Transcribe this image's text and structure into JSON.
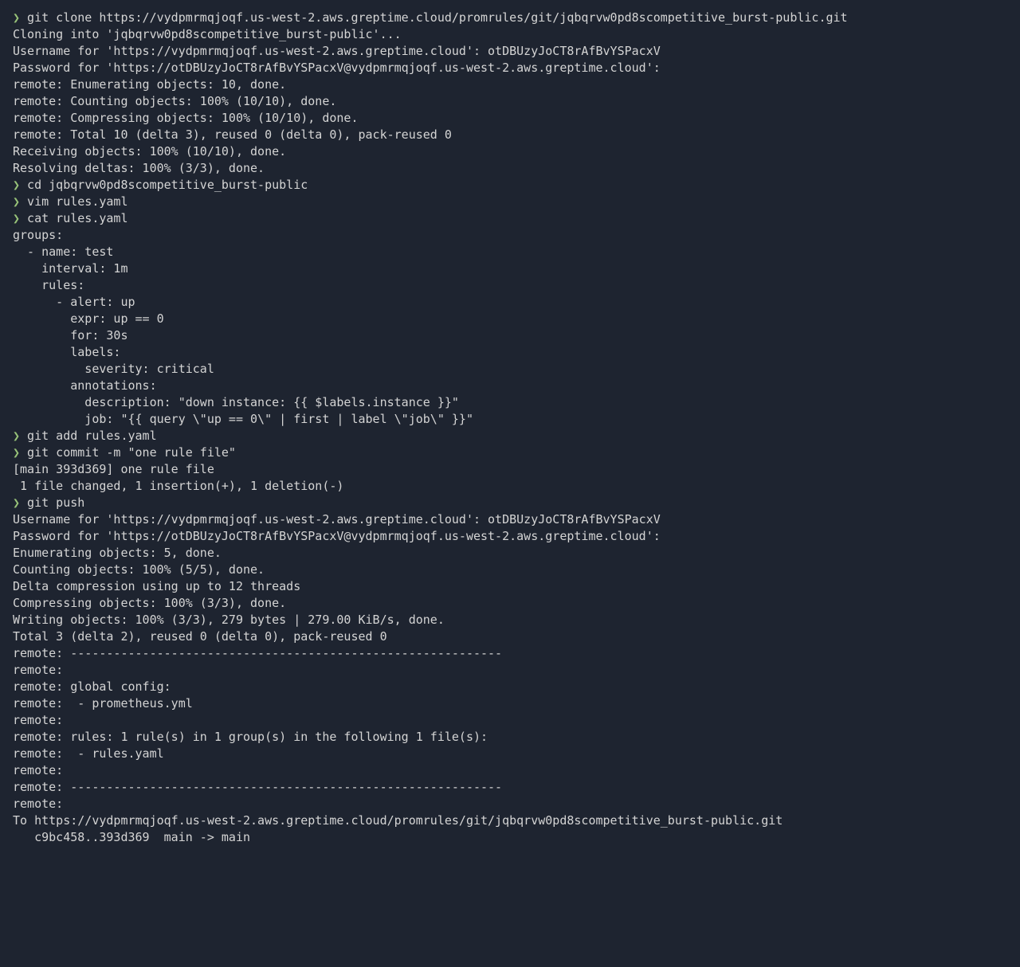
{
  "terminal": {
    "lines": [
      {
        "type": "command",
        "prompt": "❯",
        "text": "git clone https://vydpmrmqjoqf.us-west-2.aws.greptime.cloud/promrules/git/jqbqrvw0pd8scompetitive_burst-public.git"
      },
      {
        "type": "output",
        "text": "Cloning into 'jqbqrvw0pd8scompetitive_burst-public'..."
      },
      {
        "type": "output",
        "text": "Username for 'https://vydpmrmqjoqf.us-west-2.aws.greptime.cloud': otDBUzyJoCT8rAfBvYSPacxV"
      },
      {
        "type": "output",
        "text": "Password for 'https://otDBUzyJoCT8rAfBvYSPacxV@vydpmrmqjoqf.us-west-2.aws.greptime.cloud':"
      },
      {
        "type": "output",
        "text": "remote: Enumerating objects: 10, done."
      },
      {
        "type": "output",
        "text": "remote: Counting objects: 100% (10/10), done."
      },
      {
        "type": "output",
        "text": "remote: Compressing objects: 100% (10/10), done."
      },
      {
        "type": "output",
        "text": "remote: Total 10 (delta 3), reused 0 (delta 0), pack-reused 0"
      },
      {
        "type": "output",
        "text": "Receiving objects: 100% (10/10), done."
      },
      {
        "type": "output",
        "text": "Resolving deltas: 100% (3/3), done."
      },
      {
        "type": "command",
        "prompt": "❯",
        "text": "cd jqbqrvw0pd8scompetitive_burst-public"
      },
      {
        "type": "command",
        "prompt": "❯",
        "text": "vim rules.yaml"
      },
      {
        "type": "command",
        "prompt": "❯",
        "text": "cat rules.yaml"
      },
      {
        "type": "output",
        "text": "groups:"
      },
      {
        "type": "output",
        "text": "  - name: test"
      },
      {
        "type": "output",
        "text": "    interval: 1m"
      },
      {
        "type": "output",
        "text": "    rules:"
      },
      {
        "type": "output",
        "text": "      - alert: up"
      },
      {
        "type": "output",
        "text": "        expr: up == 0"
      },
      {
        "type": "output",
        "text": "        for: 30s"
      },
      {
        "type": "output",
        "text": "        labels:"
      },
      {
        "type": "output",
        "text": "          severity: critical"
      },
      {
        "type": "output",
        "text": "        annotations:"
      },
      {
        "type": "output",
        "text": "          description: \"down instance: {{ $labels.instance }}\""
      },
      {
        "type": "output",
        "text": "          job: \"{{ query \\\"up == 0\\\" | first | label \\\"job\\\" }}\""
      },
      {
        "type": "command",
        "prompt": "❯",
        "text": "git add rules.yaml"
      },
      {
        "type": "command",
        "prompt": "❯",
        "text": "git commit -m \"one rule file\""
      },
      {
        "type": "output",
        "text": "[main 393d369] one rule file"
      },
      {
        "type": "output",
        "text": " 1 file changed, 1 insertion(+), 1 deletion(-)"
      },
      {
        "type": "command",
        "prompt": "❯",
        "text": "git push"
      },
      {
        "type": "output",
        "text": "Username for 'https://vydpmrmqjoqf.us-west-2.aws.greptime.cloud': otDBUzyJoCT8rAfBvYSPacxV"
      },
      {
        "type": "output",
        "text": "Password for 'https://otDBUzyJoCT8rAfBvYSPacxV@vydpmrmqjoqf.us-west-2.aws.greptime.cloud':"
      },
      {
        "type": "output",
        "text": "Enumerating objects: 5, done."
      },
      {
        "type": "output",
        "text": "Counting objects: 100% (5/5), done."
      },
      {
        "type": "output",
        "text": "Delta compression using up to 12 threads"
      },
      {
        "type": "output",
        "text": "Compressing objects: 100% (3/3), done."
      },
      {
        "type": "output",
        "text": "Writing objects: 100% (3/3), 279 bytes | 279.00 KiB/s, done."
      },
      {
        "type": "output",
        "text": "Total 3 (delta 2), reused 0 (delta 0), pack-reused 0"
      },
      {
        "type": "output",
        "text": "remote: ------------------------------------------------------------"
      },
      {
        "type": "output",
        "text": "remote:"
      },
      {
        "type": "output",
        "text": "remote: global config:"
      },
      {
        "type": "output",
        "text": "remote:  - prometheus.yml"
      },
      {
        "type": "output",
        "text": "remote:"
      },
      {
        "type": "output",
        "text": "remote: rules: 1 rule(s) in 1 group(s) in the following 1 file(s):"
      },
      {
        "type": "output",
        "text": "remote:  - rules.yaml"
      },
      {
        "type": "output",
        "text": "remote:"
      },
      {
        "type": "output",
        "text": "remote: ------------------------------------------------------------"
      },
      {
        "type": "output",
        "text": "remote:"
      },
      {
        "type": "output",
        "text": "To https://vydpmrmqjoqf.us-west-2.aws.greptime.cloud/promrules/git/jqbqrvw0pd8scompetitive_burst-public.git"
      },
      {
        "type": "output",
        "text": "   c9bc458..393d369  main -> main"
      }
    ]
  }
}
